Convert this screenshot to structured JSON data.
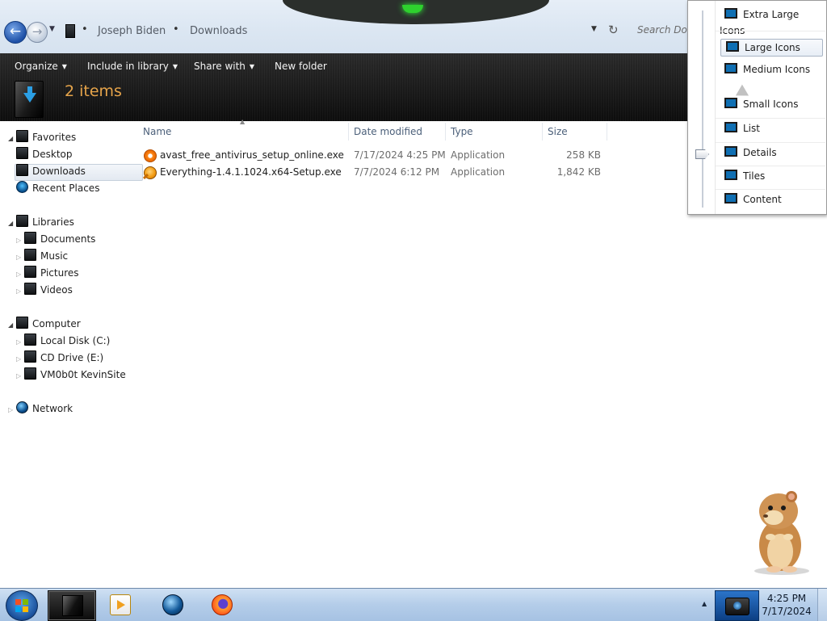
{
  "address": {
    "breadcrumb": [
      "Joseph Biden",
      "Downloads"
    ],
    "search_placeholder": "Search Dow"
  },
  "toolbar": {
    "organize": "Organize",
    "include_in_library": "Include in library",
    "share_with": "Share with",
    "new_folder": "New folder"
  },
  "header": {
    "items_count": "2 items"
  },
  "nav": {
    "favorites": "Favorites",
    "desktop": "Desktop",
    "downloads": "Downloads",
    "recent_places": "Recent Places",
    "libraries": "Libraries",
    "documents": "Documents",
    "music": "Music",
    "pictures": "Pictures",
    "videos": "Videos",
    "computer": "Computer",
    "local_disk": "Local Disk (C:)",
    "cd_drive": "CD Drive (E:)",
    "network_drive": "VM0b0t KevinSite",
    "network": "Network"
  },
  "columns": {
    "name": "Name",
    "date_modified": "Date modified",
    "type": "Type",
    "size": "Size"
  },
  "files": [
    {
      "name": "avast_free_antivirus_setup_online.exe",
      "date": "7/17/2024 4:25 PM",
      "type": "Application",
      "size": "258 KB",
      "icon": "avast-icon"
    },
    {
      "name": "Everything-1.4.1.1024.x64-Setup.exe",
      "date": "7/7/2024 6:12 PM",
      "type": "Application",
      "size": "1,842 KB",
      "icon": "everything-icon"
    }
  ],
  "view_menu": {
    "items": [
      "Extra Large Icons",
      "Large Icons",
      "Medium Icons",
      "Small Icons",
      "List",
      "Details",
      "Tiles",
      "Content"
    ],
    "hovered": "Large Icons",
    "selected": "Details"
  },
  "taskbar": {
    "time": "4:25 PM",
    "date": "7/17/2024"
  }
}
